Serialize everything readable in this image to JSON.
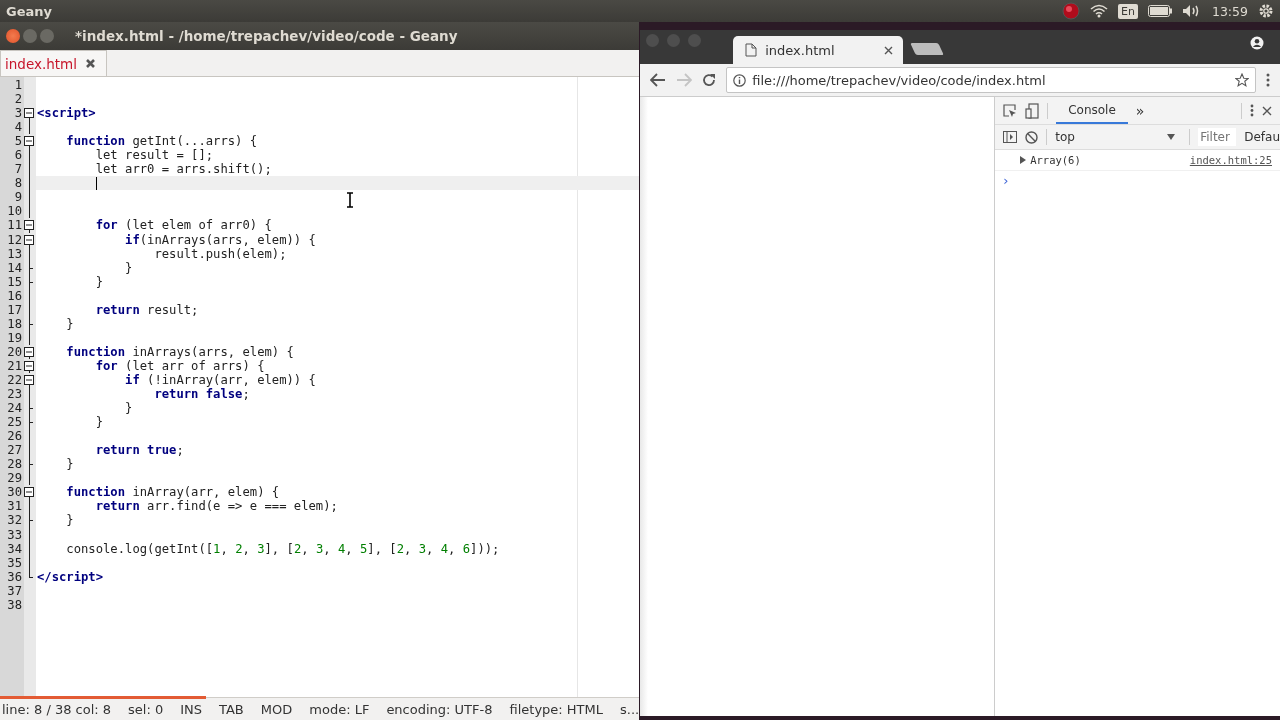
{
  "top_panel": {
    "app_name": "Geany",
    "keyboard_layout": "En",
    "time": "13:59"
  },
  "editor_window": {
    "title": "*index.html - /home/trepachev/video/code - Geany",
    "tabs": [
      {
        "label": "index.html",
        "modified": true,
        "selected": true
      }
    ],
    "lines": [
      {
        "number": "1",
        "kind": "plain",
        "current": false
      },
      {
        "number": "2",
        "kind": "plain",
        "current": false
      },
      {
        "number": "3",
        "kind": "fold_start",
        "current": false,
        "tokens": [
          {
            "kind": "tag",
            "text": "<script>"
          }
        ]
      },
      {
        "number": "4",
        "kind": "fold_body",
        "current": false
      },
      {
        "number": "5",
        "kind": "fold_start",
        "current": false,
        "tokens": [
          {
            "kind": "keyword",
            "text": "    function"
          },
          {
            "kind": "plain",
            "text": " getInt(...arrs) {"
          }
        ]
      },
      {
        "number": "6",
        "kind": "fold_body",
        "current": false,
        "tokens": [
          {
            "kind": "plain",
            "text": "        let result = [];"
          }
        ]
      },
      {
        "number": "7",
        "kind": "fold_body",
        "current": false,
        "tokens": [
          {
            "kind": "plain",
            "text": "        let arr0 = arrs.shift();"
          }
        ]
      },
      {
        "number": "8",
        "kind": "fold_body",
        "current": true
      },
      {
        "number": "9",
        "kind": "fold_body",
        "current": false
      },
      {
        "number": "10",
        "kind": "fold_body",
        "current": false
      },
      {
        "number": "11",
        "kind": "fold_start",
        "current": false,
        "tokens": [
          {
            "kind": "keyword",
            "text": "        for"
          },
          {
            "kind": "plain",
            "text": " (let elem of arr0) {"
          }
        ]
      },
      {
        "number": "12",
        "kind": "fold_start",
        "current": false,
        "tokens": [
          {
            "kind": "keyword",
            "text": "            if"
          },
          {
            "kind": "plain",
            "text": "(inArrays(arrs, elem)) {"
          }
        ]
      },
      {
        "number": "13",
        "kind": "fold_body",
        "current": false,
        "tokens": [
          {
            "kind": "plain",
            "text": "                result.push(elem);"
          }
        ]
      },
      {
        "number": "14",
        "kind": "fold_close",
        "current": false,
        "tokens": [
          {
            "kind": "plain",
            "text": "            }"
          }
        ]
      },
      {
        "number": "15",
        "kind": "fold_close",
        "current": false,
        "tokens": [
          {
            "kind": "plain",
            "text": "        }"
          }
        ]
      },
      {
        "number": "16",
        "kind": "fold_body",
        "current": false
      },
      {
        "number": "17",
        "kind": "fold_body",
        "current": false,
        "tokens": [
          {
            "kind": "keyword",
            "text": "        return"
          },
          {
            "kind": "plain",
            "text": " result;"
          }
        ]
      },
      {
        "number": "18",
        "kind": "fold_close",
        "current": false,
        "tokens": [
          {
            "kind": "plain",
            "text": "    }"
          }
        ]
      },
      {
        "number": "19",
        "kind": "fold_body",
        "current": false
      },
      {
        "number": "20",
        "kind": "fold_start",
        "current": false,
        "tokens": [
          {
            "kind": "keyword",
            "text": "    function"
          },
          {
            "kind": "plain",
            "text": " inArrays(arrs, elem) {"
          }
        ]
      },
      {
        "number": "21",
        "kind": "fold_start",
        "current": false,
        "tokens": [
          {
            "kind": "keyword",
            "text": "        for"
          },
          {
            "kind": "plain",
            "text": " (let arr of arrs) {"
          }
        ]
      },
      {
        "number": "22",
        "kind": "fold_start",
        "current": false,
        "tokens": [
          {
            "kind": "keyword",
            "text": "            if"
          },
          {
            "kind": "plain",
            "text": " (!inArray(arr, elem)) {"
          }
        ]
      },
      {
        "number": "23",
        "kind": "fold_body",
        "current": false,
        "tokens": [
          {
            "kind": "keyword",
            "text": "                return false"
          },
          {
            "kind": "plain",
            "text": ";"
          }
        ]
      },
      {
        "number": "24",
        "kind": "fold_close",
        "current": false,
        "tokens": [
          {
            "kind": "plain",
            "text": "            }"
          }
        ]
      },
      {
        "number": "25",
        "kind": "fold_close",
        "current": false,
        "tokens": [
          {
            "kind": "plain",
            "text": "        }"
          }
        ]
      },
      {
        "number": "26",
        "kind": "fold_body",
        "current": false
      },
      {
        "number": "27",
        "kind": "fold_body",
        "current": false,
        "tokens": [
          {
            "kind": "keyword",
            "text": "        return true"
          },
          {
            "kind": "plain",
            "text": ";"
          }
        ]
      },
      {
        "number": "28",
        "kind": "fold_close",
        "current": false,
        "tokens": [
          {
            "kind": "plain",
            "text": "    }"
          }
        ]
      },
      {
        "number": "29",
        "kind": "fold_body",
        "current": false
      },
      {
        "number": "30",
        "kind": "fold_start",
        "current": false,
        "tokens": [
          {
            "kind": "keyword",
            "text": "    function"
          },
          {
            "kind": "plain",
            "text": " inArray(arr, elem) {"
          }
        ]
      },
      {
        "number": "31",
        "kind": "fold_body",
        "current": false,
        "tokens": [
          {
            "kind": "keyword",
            "text": "        return"
          },
          {
            "kind": "plain",
            "text": " arr.find(e => e === elem);"
          }
        ]
      },
      {
        "number": "32",
        "kind": "fold_close",
        "current": false,
        "tokens": [
          {
            "kind": "plain",
            "text": "    }"
          }
        ]
      },
      {
        "number": "33",
        "kind": "fold_body",
        "current": false
      },
      {
        "number": "34",
        "kind": "fold_body",
        "current": false,
        "tokens": [
          {
            "kind": "plain",
            "text": "    console.log(getInt(["
          },
          {
            "kind": "number",
            "text": "1"
          },
          {
            "kind": "plain",
            "text": ", "
          },
          {
            "kind": "number",
            "text": "2"
          },
          {
            "kind": "plain",
            "text": ", "
          },
          {
            "kind": "number",
            "text": "3"
          },
          {
            "kind": "plain",
            "text": "], ["
          },
          {
            "kind": "number",
            "text": "2"
          },
          {
            "kind": "plain",
            "text": ", "
          },
          {
            "kind": "number",
            "text": "3"
          },
          {
            "kind": "plain",
            "text": ", "
          },
          {
            "kind": "number",
            "text": "4"
          },
          {
            "kind": "plain",
            "text": ", "
          },
          {
            "kind": "number",
            "text": "5"
          },
          {
            "kind": "plain",
            "text": "], ["
          },
          {
            "kind": "number",
            "text": "2"
          },
          {
            "kind": "plain",
            "text": ", "
          },
          {
            "kind": "number",
            "text": "3"
          },
          {
            "kind": "plain",
            "text": ", "
          },
          {
            "kind": "number",
            "text": "4"
          },
          {
            "kind": "plain",
            "text": ", "
          },
          {
            "kind": "number",
            "text": "6"
          },
          {
            "kind": "plain",
            "text": "]));"
          }
        ]
      },
      {
        "number": "35",
        "kind": "fold_body",
        "current": false
      },
      {
        "number": "36",
        "kind": "fold_end",
        "current": false,
        "tokens": [
          {
            "kind": "tag",
            "text": "</script>"
          }
        ]
      },
      {
        "number": "37",
        "kind": "plain",
        "current": false
      },
      {
        "number": "38",
        "kind": "plain",
        "current": false
      }
    ],
    "status_bar": [
      "line: 8 / 38  col: 8",
      "sel: 0",
      "INS",
      "TAB",
      "MOD",
      "mode: LF",
      "encoding: UTF-8",
      "filetype: HTML",
      "s..."
    ]
  },
  "browser_window": {
    "tabs": [
      {
        "label": "index.html",
        "selected": true
      }
    ],
    "address": "file:///home/trepachev/video/code/index.html",
    "devtools": {
      "tabs": [
        {
          "label": "Console",
          "selected": true
        }
      ],
      "more": "»",
      "context": "top",
      "filter": {
        "placeholder": "Filter"
      },
      "levels": "Defau",
      "messages": [
        {
          "text": "Array(6)",
          "source": "index.html:25"
        }
      ],
      "prompt": "›"
    }
  }
}
